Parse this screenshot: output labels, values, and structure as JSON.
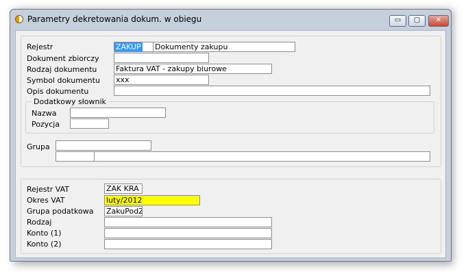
{
  "window": {
    "title": "Parametry dekretowania dokum. w obiegu",
    "buttons": {
      "minimize": "▭",
      "maximize": "▢",
      "close": "✕"
    }
  },
  "form": {
    "rejestr_label": "Rejestr",
    "rejestr_code": "ZAKUP",
    "rejestr_name": "Dokumenty zakupu",
    "dokument_zbiorczy_label": "Dokument zbiorczy",
    "dokument_zbiorczy_value": "",
    "rodzaj_dokumentu_label": "Rodzaj dokumentu",
    "rodzaj_dokumentu_value": "Faktura VAT - zakupy biurowe",
    "symbol_dokumentu_label": "Symbol dokumentu",
    "symbol_dokumentu_value": "xxx",
    "opis_dokumentu_label": "Opis dokumentu",
    "opis_dokumentu_value": "",
    "dodatkowy_slownik_label": "Dodatkowy słownik",
    "nazwa_label": "Nazwa",
    "nazwa_value": "",
    "pozycja_label": "Pozycja",
    "pozycja_value": "",
    "grupa_label": "Grupa",
    "grupa_value": "",
    "grupa_row2_a": "",
    "grupa_row2_b": ""
  },
  "vat": {
    "rejestr_vat_label": "Rejestr VAT",
    "rejestr_vat_value": "ZAK KRA",
    "okres_vat_label": "Okres VAT",
    "okres_vat_value": "luty/2012",
    "okres_vat_highlight": "#ffff00",
    "grupa_podatkowa_label": "Grupa podatkowa",
    "grupa_podatkowa_value": "ZakuPodZ",
    "rodzaj_label": "Rodzaj",
    "rodzaj_value": "",
    "konto1_label": "Konto (1)",
    "konto1_value": "",
    "konto2_label": "Konto (2)",
    "konto2_value": ""
  }
}
